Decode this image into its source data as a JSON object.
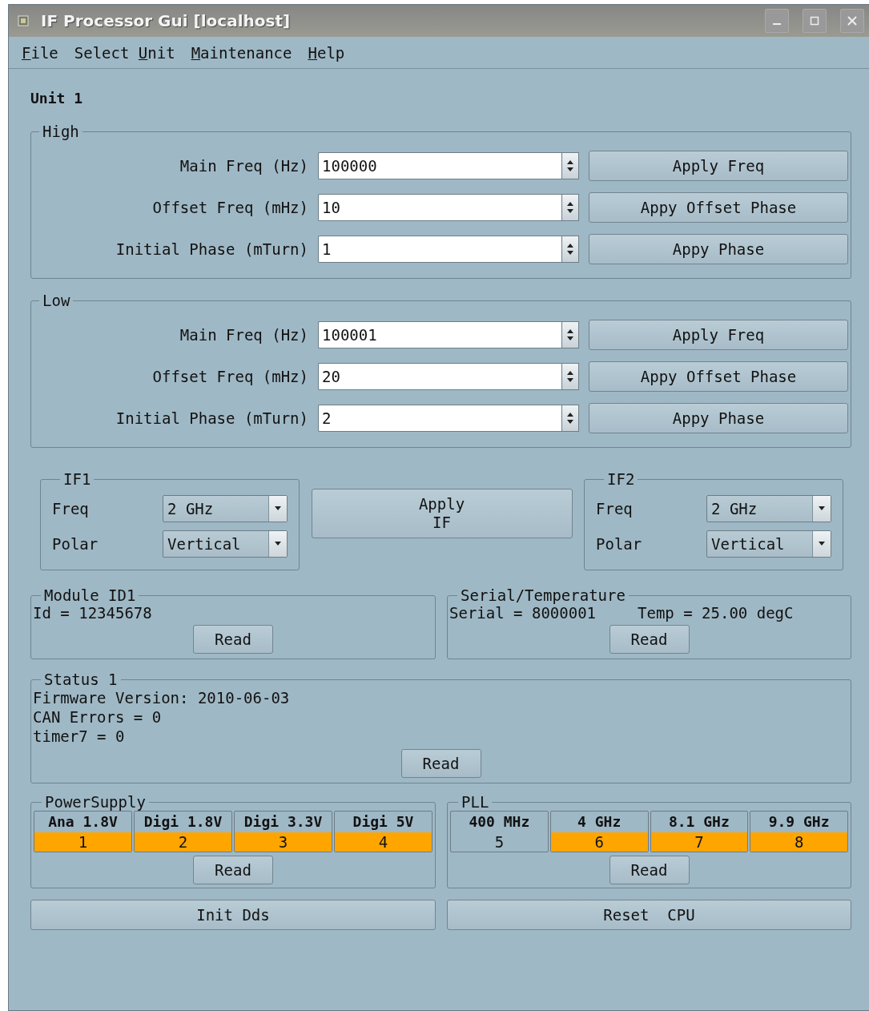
{
  "window": {
    "title": "IF Processor Gui [localhost]"
  },
  "menu": [
    {
      "key": "F",
      "rest": "ile"
    },
    {
      "prefix": "Select ",
      "key": "U",
      "rest": "nit"
    },
    {
      "key": "M",
      "rest": "aintenance"
    },
    {
      "key": "H",
      "rest": "elp"
    }
  ],
  "unit_title": "Unit 1",
  "freq_groups": [
    {
      "title": "High",
      "rows": [
        {
          "label": "Main Freq (Hz)",
          "value": "100000",
          "button": "Apply Freq"
        },
        {
          "label": "Offset Freq (mHz)",
          "value": "10",
          "button": "Appy Offset Phase"
        },
        {
          "label": "Initial Phase (mTurn)",
          "value": "1",
          "button": "Appy Phase"
        }
      ]
    },
    {
      "title": "Low",
      "rows": [
        {
          "label": "Main Freq (Hz)",
          "value": "100001",
          "button": "Apply Freq"
        },
        {
          "label": "Offset Freq (mHz)",
          "value": "20",
          "button": "Appy Offset Phase"
        },
        {
          "label": "Initial Phase (mTurn)",
          "value": "2",
          "button": "Appy Phase"
        }
      ]
    }
  ],
  "if_groups": [
    {
      "title": "IF1",
      "rows": [
        {
          "label": "Freq",
          "value": "2 GHz"
        },
        {
          "label": "Polar",
          "value": "Vertical"
        }
      ]
    },
    {
      "title": "IF2",
      "rows": [
        {
          "label": "Freq",
          "value": "2 GHz"
        },
        {
          "label": "Polar",
          "value": "Vertical"
        }
      ]
    }
  ],
  "apply_if_button": "Apply\nIF",
  "module_id": {
    "title": "Module ID1",
    "texts": [
      "Id = 12345678"
    ],
    "button": "Read"
  },
  "serial_temp": {
    "title": "Serial/Temperature",
    "texts": [
      "Serial = 8000001",
      "Temp = 25.00 degC"
    ],
    "button": "Read"
  },
  "status": {
    "title": "Status 1",
    "lines": [
      "Firmware Version: 2010-06-03",
      "CAN Errors = 0",
      "timer7 = 0"
    ],
    "button": "Read"
  },
  "indicator_groups": [
    {
      "title": "PowerSupply",
      "button": "Read",
      "items": [
        {
          "label": "Ana 1.8V",
          "number": "1",
          "on": true
        },
        {
          "label": "Digi 1.8V",
          "number": "2",
          "on": true
        },
        {
          "label": "Digi 3.3V",
          "number": "3",
          "on": true
        },
        {
          "label": "Digi 5V",
          "number": "4",
          "on": true
        }
      ]
    },
    {
      "title": "PLL",
      "button": "Read",
      "items": [
        {
          "label": "400 MHz",
          "number": "5",
          "on": false
        },
        {
          "label": "4 GHz",
          "number": "6",
          "on": true
        },
        {
          "label": "8.1 GHz",
          "number": "7",
          "on": true
        },
        {
          "label": "9.9 GHz",
          "number": "8",
          "on": true
        }
      ]
    }
  ],
  "bottom_buttons": [
    "Init Dds",
    "Reset  CPU"
  ]
}
